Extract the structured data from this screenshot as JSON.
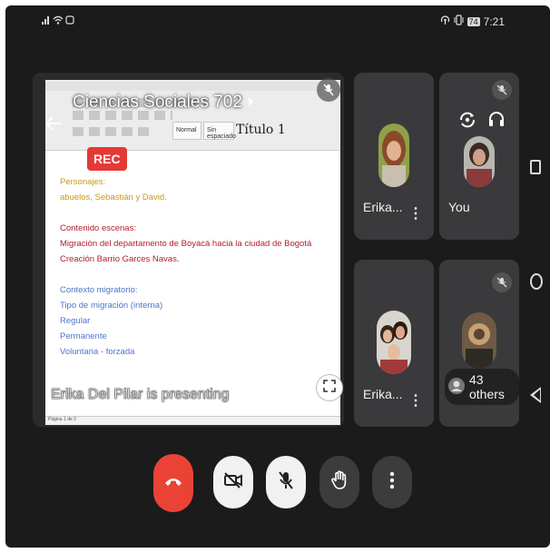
{
  "status_bar": {
    "left_icons": [
      "signal-icon",
      "wifi-icon",
      "notification-icon"
    ],
    "right_icons": [
      "hotspot-icon",
      "vibrate-icon"
    ],
    "battery": "74",
    "time": "7:21"
  },
  "presentation": {
    "title": "Ciencias Sociales 702",
    "rec_label": "REC",
    "presenting_label": "Erika Del Pilar is presenting",
    "ribbon_style_normal": "Normal",
    "ribbon_style_nospace": "Sin espaciado",
    "ribbon_style_title1": "Título 1",
    "doc_lines": [
      {
        "text": "Personajes:",
        "color": "gold"
      },
      {
        "text": "abuelos, Sebastián y David.",
        "color": "gold"
      },
      {
        "text": "",
        "color": "none"
      },
      {
        "text": "Contenido escenas:",
        "color": "red"
      },
      {
        "text": "Migración del departamento de Boyacá hacia la ciudad de Bogotá",
        "color": "red"
      },
      {
        "text": "Creación Barrio Garces Navas.",
        "color": "red"
      },
      {
        "text": "",
        "color": "none"
      },
      {
        "text": "Contexto migratorio:",
        "color": "blue"
      },
      {
        "text": "Tipo de migración (interna)",
        "color": "blue"
      },
      {
        "text": "Regular",
        "color": "blue"
      },
      {
        "text": "Permanente",
        "color": "blue"
      },
      {
        "text": "Voluntaria - forzada",
        "color": "blue"
      }
    ]
  },
  "participants": [
    {
      "name": "Erika...",
      "muted": false
    },
    {
      "name": "You",
      "muted": true
    },
    {
      "name": "Erika...",
      "muted": false
    },
    {
      "name": "43 others",
      "muted": true
    }
  ],
  "colors": {
    "end_call": "#ea4335",
    "rec": "#e53935",
    "tile_bg": "#3a3a3c",
    "background": "#1b1b1b"
  }
}
